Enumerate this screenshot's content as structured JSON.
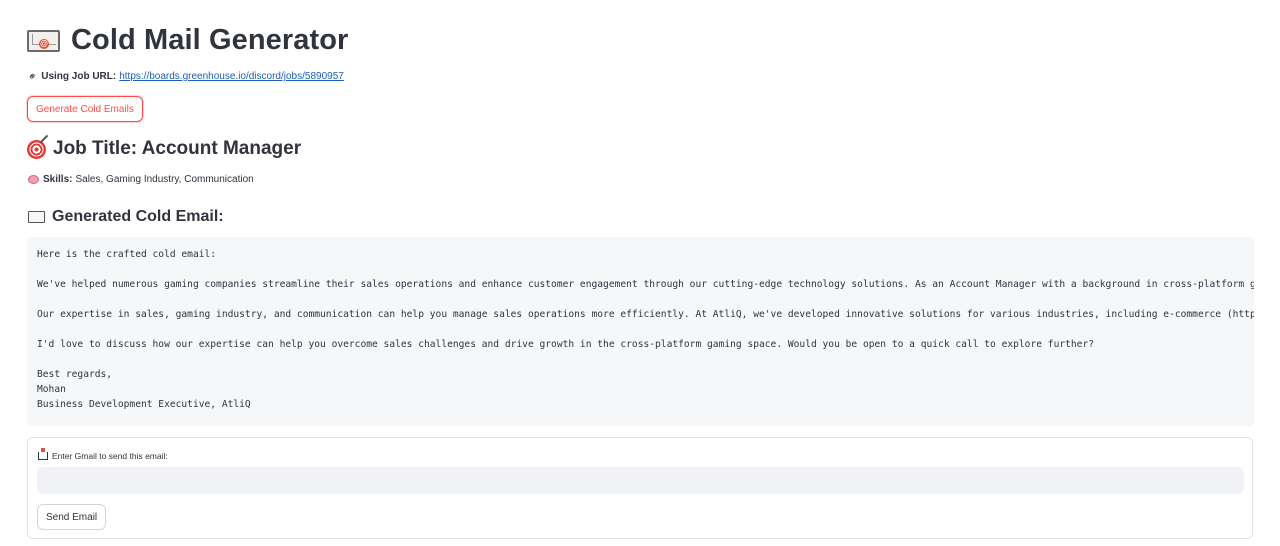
{
  "header": {
    "icon": "envelope-with-at-icon",
    "title": "Cold Mail Generator"
  },
  "job_url": {
    "icon": "paperclip-icon",
    "label": "Using Job URL:",
    "url": "https://boards.greenhouse.io/discord/jobs/5890957"
  },
  "actions": {
    "generate_label": "Generate Cold Emails"
  },
  "job": {
    "icon": "target-icon",
    "title": "Job Title: Account Manager",
    "skills_icon": "brain-icon",
    "skills_label": "Skills:",
    "skills_value": "Sales, Gaming Industry, Communication"
  },
  "generated": {
    "icon": "envelope-icon",
    "heading": "Generated Cold Email:",
    "lines": [
      "Here is the crafted cold email:",
      "We've helped numerous gaming companies streamline their sales operations and enhance customer engagement through our cutting-edge technology solutions. As an Account Manager with a background in cross-platform gaming,",
      "Our expertise in sales, gaming industry, and communication can help you manage sales operations more efficiently. At AtliQ, we've developed innovative solutions for various industries, including e-commerce (https://ex",
      "I'd love to discuss how our expertise can help you overcome sales challenges and drive growth in the cross-platform gaming space. Would you be open to a quick call to explore further?",
      "Best regards,",
      "Mohan",
      "Business Development Executive, AtliQ"
    ]
  },
  "send_form": {
    "icon": "inbox-tray-icon",
    "label": "Enter Gmail to send this email:",
    "value": "",
    "placeholder": "",
    "send_label": "Send Email"
  },
  "colors": {
    "accent": "#ff4b4b",
    "link": "#1a5fb4",
    "text": "#31333f",
    "code_bg": "#f6f7f9",
    "input_bg": "#f0f2f6"
  }
}
